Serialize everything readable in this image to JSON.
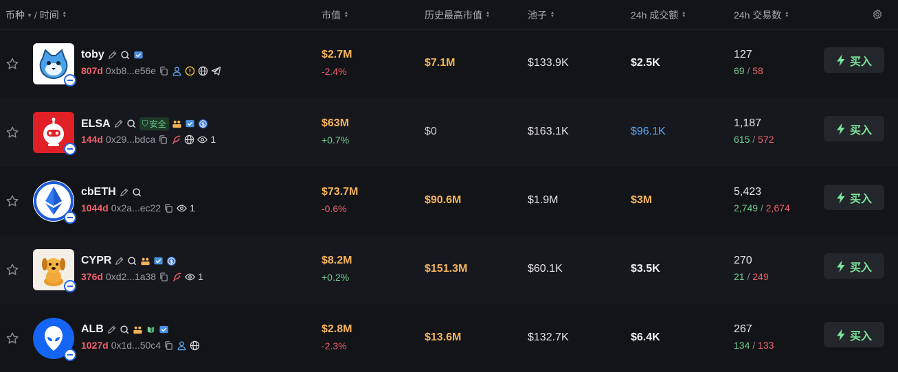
{
  "header": {
    "coin": "币种",
    "time": "/ 时间",
    "mcap": "市值",
    "ath": "历史最高市值",
    "pool": "池子",
    "vol": "24h 成交额",
    "txs": "24h 交易数"
  },
  "buy_label": "买入",
  "colors": {
    "accent_green": "#7ce39a",
    "red": "#f0616d",
    "orange": "#f5b45a",
    "blue": "#5aa9f7"
  },
  "rows": [
    {
      "name": "toby",
      "age": "807d",
      "addr": "0xb8...e56e",
      "mcap": "$2.7M",
      "change": "-2.4%",
      "ath": "$7.1M",
      "pool": "$133.9K",
      "vol": "$2.5K",
      "txs": "127",
      "buys": "69",
      "sells": "58"
    },
    {
      "name": "ELSA",
      "safe": "安全",
      "age": "144d",
      "addr": "0x29...bdca",
      "holders": "1",
      "mcap": "$63M",
      "change": "+0.7%",
      "ath": "$0",
      "pool": "$163.1K",
      "vol": "$96.1K",
      "txs": "1,187",
      "buys": "615",
      "sells": "572"
    },
    {
      "name": "cbETH",
      "age": "1044d",
      "addr": "0x2a...ec22",
      "holders": "1",
      "mcap": "$73.7M",
      "change": "-0.6%",
      "ath": "$90.6M",
      "pool": "$1.9M",
      "vol": "$3M",
      "txs": "5,423",
      "buys": "2,749",
      "sells": "2,674"
    },
    {
      "name": "CYPR",
      "age": "376d",
      "addr": "0xd2...1a38",
      "holders": "1",
      "mcap": "$8.2M",
      "change": "+0.2%",
      "ath": "$151.3M",
      "pool": "$60.1K",
      "vol": "$3.5K",
      "txs": "270",
      "buys": "21",
      "sells": "249"
    },
    {
      "name": "ALB",
      "age": "1027d",
      "addr": "0x1d...50c4",
      "mcap": "$2.8M",
      "change": "-2.3%",
      "ath": "$13.6M",
      "pool": "$132.7K",
      "vol": "$6.4K",
      "txs": "267",
      "buys": "134",
      "sells": "133"
    }
  ]
}
